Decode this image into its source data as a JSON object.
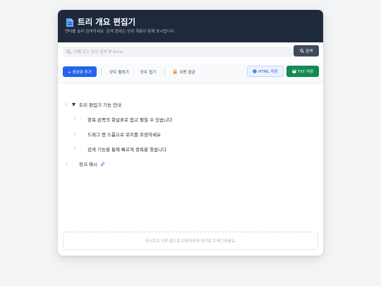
{
  "header": {
    "title": "트리 개요 편집기",
    "subtitle": "엔터를 눌러 검색하세요. 검색 중에는 상위 계층이 함께 표시됩니다.",
    "icon": "document-icon"
  },
  "search": {
    "placeholder": "이름 또는 링크 검색 후 Enter",
    "value": "",
    "button_label": "검색",
    "button_icon": "search-icon"
  },
  "toolbar": {
    "add_label": "+ 최상위 추가",
    "expand_label": "모두 펼치기",
    "collapse_label": "모두 접기",
    "lock_label": "이동 잠금",
    "html_label": "HTML 저장",
    "txt_label": "TXT 저장"
  },
  "tree": {
    "items": [
      {
        "label": "트리 편집기 기능 안내",
        "toggle": "▼",
        "level": 0
      },
      {
        "label": "항목 왼쪽의 화살표로 접고 펼칠 수 있습니다",
        "toggle": "·",
        "level": 1
      },
      {
        "label": "드래그 앤 드롭으로 위치를 조정하세요",
        "toggle": "·",
        "level": 1
      },
      {
        "label": "검색 기능을 통해 빠르게 항목을 찾습니다",
        "toggle": "·",
        "level": 1
      },
      {
        "label": "링크 예시",
        "toggle": "·",
        "level": 0,
        "has_link": true
      }
    ]
  },
  "dropzone": {
    "text": "리스트의 가장 끝으로 이동하려면 여기로 드래그하세요."
  },
  "colors": {
    "header_bg": "#1e293b",
    "primary": "#2563eb",
    "success": "#138a53",
    "search_button": "#3f4b5c"
  }
}
